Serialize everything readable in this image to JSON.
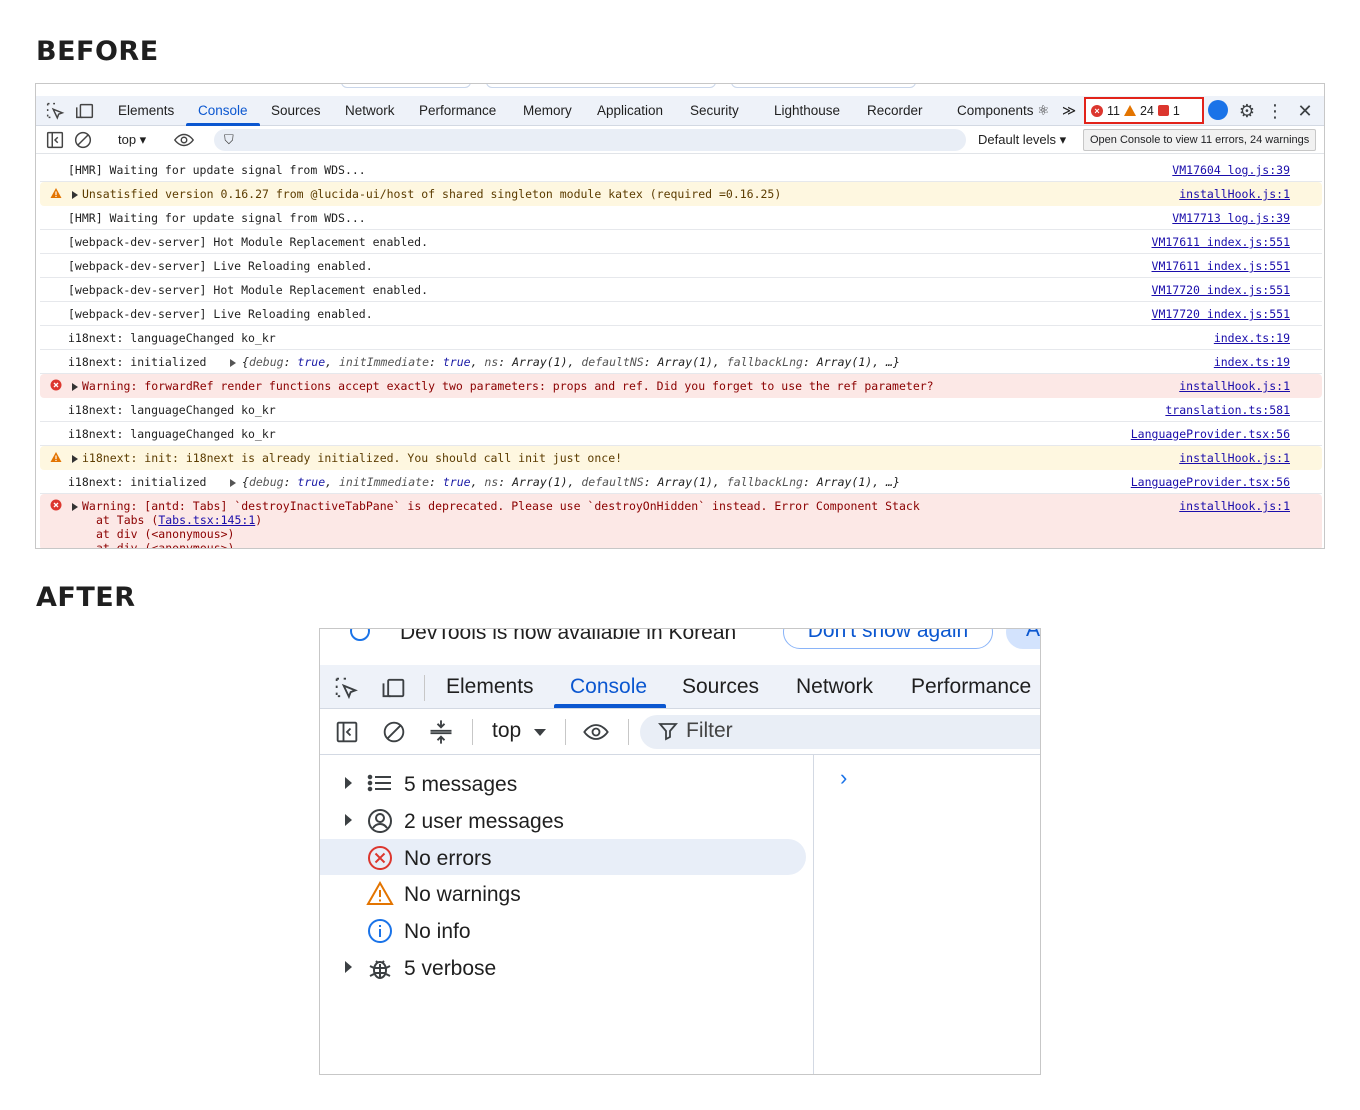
{
  "headings": {
    "before": "BEFORE",
    "after": "AFTER"
  },
  "before": {
    "tabs": [
      "Elements",
      "Console",
      "Sources",
      "Network",
      "Performance",
      "Memory",
      "Application",
      "Security",
      "Lighthouse",
      "Recorder",
      "Components ⚛"
    ],
    "active_tab": "Console",
    "more_tabs": "≫",
    "counts": {
      "errors": "11",
      "warnings": "24",
      "issues": "1"
    },
    "toolbar": {
      "context": "top ▾",
      "levels": "Default levels ▾",
      "filter_icon": "⛉"
    },
    "tooltip": "Open Console to view 11 errors, 24 warnings",
    "log": [
      {
        "level": "log",
        "message": "[HMR] Waiting for update signal from WDS...",
        "source": "VM17604 log.js:39"
      },
      {
        "level": "warning",
        "message": "Unsatisfied version 0.16.27 from @lucida-ui/host of shared singleton module katex (required =0.16.25)",
        "source": "installHook.js:1"
      },
      {
        "level": "log",
        "message": "[HMR] Waiting for update signal from WDS...",
        "source": "VM17713 log.js:39"
      },
      {
        "level": "log",
        "message": "[webpack-dev-server] Hot Module Replacement enabled.",
        "source": "VM17611 index.js:551"
      },
      {
        "level": "log",
        "message": "[webpack-dev-server] Live Reloading enabled.",
        "source": "VM17611 index.js:551"
      },
      {
        "level": "log",
        "message": "[webpack-dev-server] Hot Module Replacement enabled.",
        "source": "VM17720 index.js:551"
      },
      {
        "level": "log",
        "message": "[webpack-dev-server] Live Reloading enabled.",
        "source": "VM17720 index.js:551"
      },
      {
        "level": "log",
        "message": "i18next: languageChanged ko_kr",
        "source": "index.ts:19"
      },
      {
        "level": "object",
        "message": "i18next: initialized",
        "object": "{debug: true, initImmediate: true, ns: Array(1), defaultNS: Array(1), fallbackLng: Array(1), …}",
        "source": "index.ts:19"
      },
      {
        "level": "error",
        "message": "Warning: forwardRef render functions accept exactly two parameters: props and ref. Did you forget to use the ref parameter?",
        "source": "installHook.js:1"
      },
      {
        "level": "log",
        "message": "i18next: languageChanged ko_kr",
        "source": "translation.ts:581"
      },
      {
        "level": "log",
        "message": "i18next: languageChanged ko_kr",
        "source": "LanguageProvider.tsx:56"
      },
      {
        "level": "warning",
        "message": "i18next: init: i18next is already initialized. You should call init just once!",
        "source": "installHook.js:1"
      },
      {
        "level": "object",
        "message": "i18next: initialized",
        "object": "{debug: true, initImmediate: true, ns: Array(1), defaultNS: Array(1), fallbackLng: Array(1), …}",
        "source": "LanguageProvider.tsx:56"
      }
    ],
    "last_error": {
      "message": "Warning: [antd: Tabs] `destroyInactiveTabPane` is deprecated. Please use `destroyOnHidden` instead. Error Component Stack",
      "source": "installHook.js:1",
      "stack1_prefix": "at Tabs (",
      "stack1_link": "Tabs.tsx:145:1",
      "stack1_suffix": ")",
      "stack2": "at div (<anonymous>)",
      "stack3": "at div (<anonymous>)"
    }
  },
  "after": {
    "banner": {
      "text": "DevTools is now available in Korean",
      "button": "Don't show again",
      "button2": "A"
    },
    "tabs": [
      "Elements",
      "Console",
      "Sources",
      "Network",
      "Performance"
    ],
    "active_tab": "Console",
    "toolbar": {
      "context": "top",
      "filter_placeholder": "Filter"
    },
    "sidebar": [
      {
        "label": "5 messages",
        "icon": "list-icon",
        "expandable": true
      },
      {
        "label": "2 user messages",
        "icon": "user-icon",
        "expandable": true
      },
      {
        "label": "No errors",
        "icon": "error-icon",
        "expandable": false,
        "selected": true
      },
      {
        "label": "No warnings",
        "icon": "warning-icon",
        "expandable": false
      },
      {
        "label": "No info",
        "icon": "info-icon",
        "expandable": false
      },
      {
        "label": "5 verbose",
        "icon": "bug-icon",
        "expandable": true
      }
    ],
    "prompt": "›"
  },
  "colors": {
    "accent": "#0b57d0",
    "error": "#dc362e",
    "warning": "#e37400",
    "info": "#1a73e8"
  }
}
